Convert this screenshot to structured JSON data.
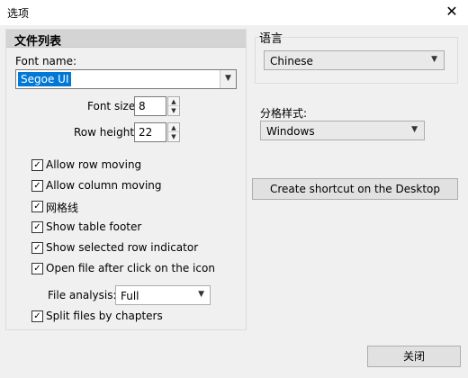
{
  "window": {
    "title": "选项",
    "close_glyph": "✕"
  },
  "file_list": {
    "title": "文件列表",
    "font_name_label": "Font name:",
    "font_name_value": "Segoe UI",
    "font_size_label": "Font size:",
    "font_size_value": "8",
    "row_height_label": "Row height:",
    "row_height_value": "22",
    "checkboxes": [
      {
        "label": "Allow row moving",
        "checked": true
      },
      {
        "label": "Allow column moving",
        "checked": true
      },
      {
        "label": "网格线",
        "checked": true
      },
      {
        "label": "Show table footer",
        "checked": true
      },
      {
        "label": "Show selected row indicator",
        "checked": true
      },
      {
        "label": "Open file after click on the icon",
        "checked": true
      },
      {
        "label": "Split files by chapters",
        "checked": true
      }
    ],
    "file_analysis_label": "File analysis:",
    "file_analysis_value": "Full"
  },
  "language": {
    "label": "语言",
    "value": "Chinese"
  },
  "split_style": {
    "label": "分格样式:",
    "value": "Windows"
  },
  "buttons": {
    "shortcut": "Create shortcut on the Desktop",
    "close": "关闭"
  },
  "glyphs": {
    "check": "✓",
    "down": "▼",
    "up": "▲"
  }
}
